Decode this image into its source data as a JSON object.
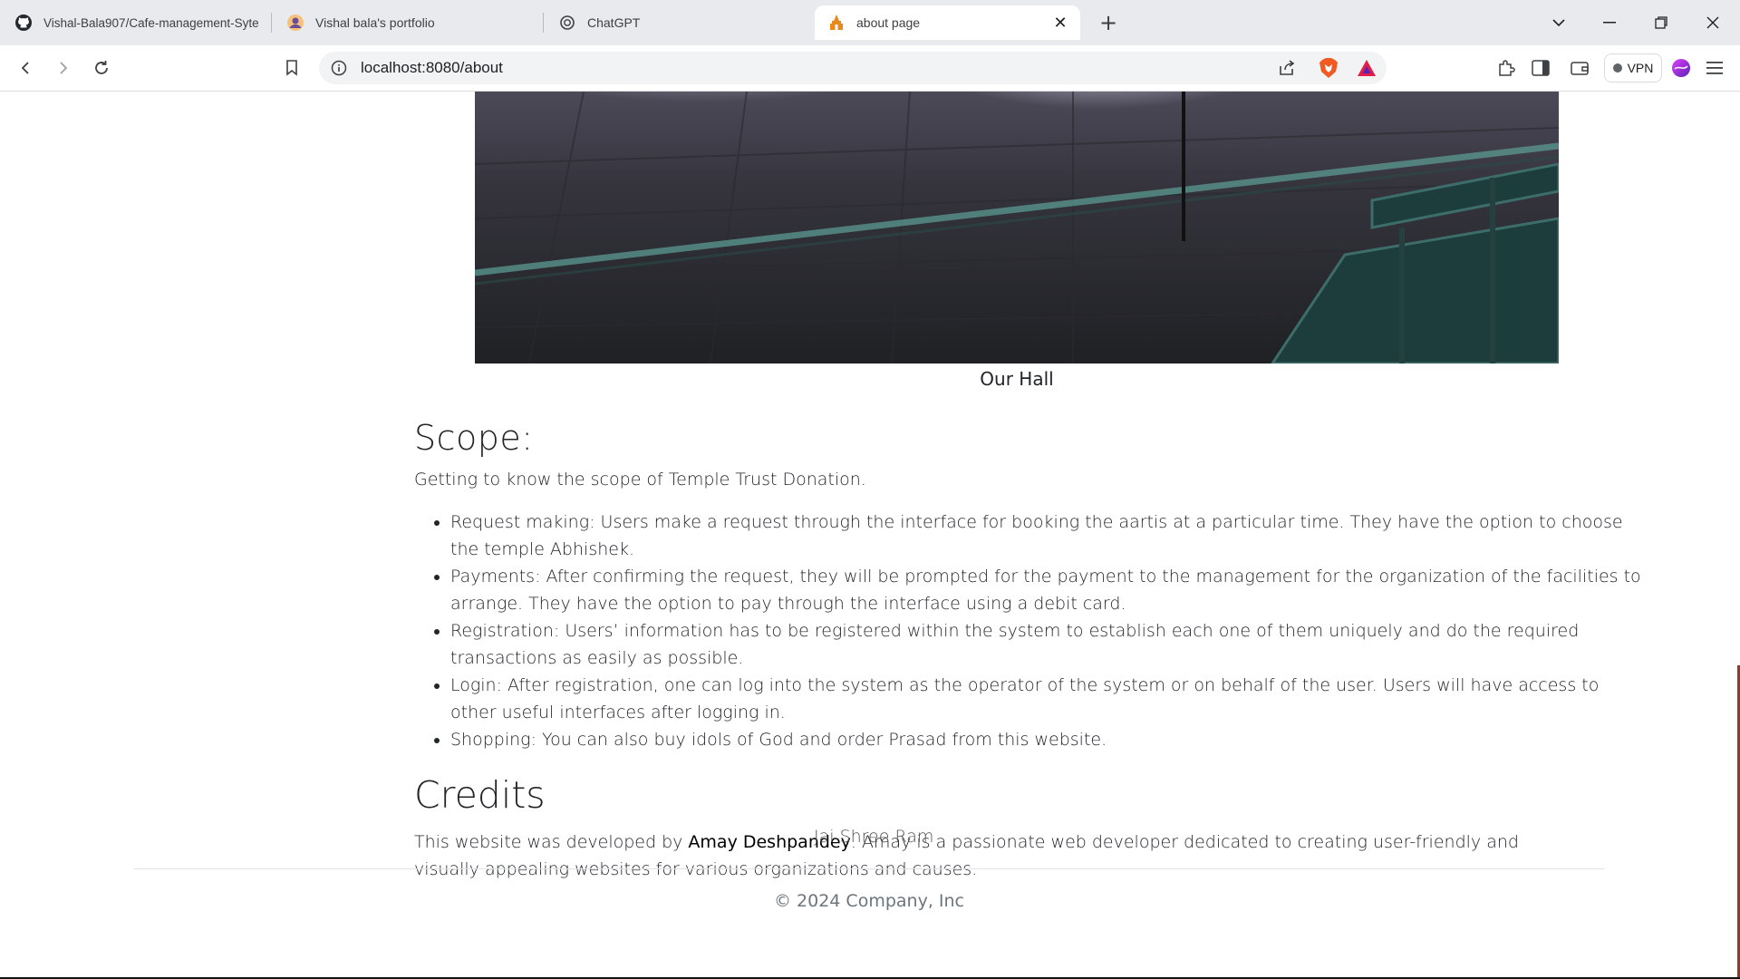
{
  "browser": {
    "tabs": [
      {
        "title": "Vishal-Bala907/Cafe-management-Syte",
        "icon": "github-icon",
        "active": false
      },
      {
        "title": "Vishal bala's portfolio",
        "icon": "avatar-icon",
        "active": false
      },
      {
        "title": "ChatGPT",
        "icon": "chatgpt-icon",
        "active": false
      },
      {
        "title": "about page",
        "icon": "temple-icon",
        "active": true
      }
    ],
    "url": "localhost:8080/about",
    "vpn_label": "VPN"
  },
  "page": {
    "image_caption": "Our Hall",
    "scope": {
      "heading": "Scope:",
      "intro": "Getting to know the scope of Temple Trust Donation.",
      "items": [
        "Request making: Users make a request through the interface for booking the aartis at a particular time. They have the option to choose the temple Abhishek.",
        "Payments: After confirming the request, they will be prompted for the payment to the management for the organization of the facilities to arrange. They have the option to pay through the interface using a debit card.",
        "Registration: Users’ information has to be registered within the system to establish each one of them uniquely and do the required transactions as easily as possible.",
        "Login: After registration, one can log into the system as the operator of the system or on behalf of the user. Users will have access to other useful interfaces after logging in.",
        "Shopping: You can also buy idols of God and order Prasad from this website."
      ]
    },
    "credits": {
      "heading": "Credits",
      "text_before": "This website was developed by ",
      "developer": "Amay Deshpandey",
      "text_after": ". Amay is a passionate web developer dedicated to creating user-friendly and visually appealing websites for various organizations and causes."
    },
    "overlay_text": "Jai Shree Ram",
    "footer": "© 2024 Company, Inc"
  }
}
